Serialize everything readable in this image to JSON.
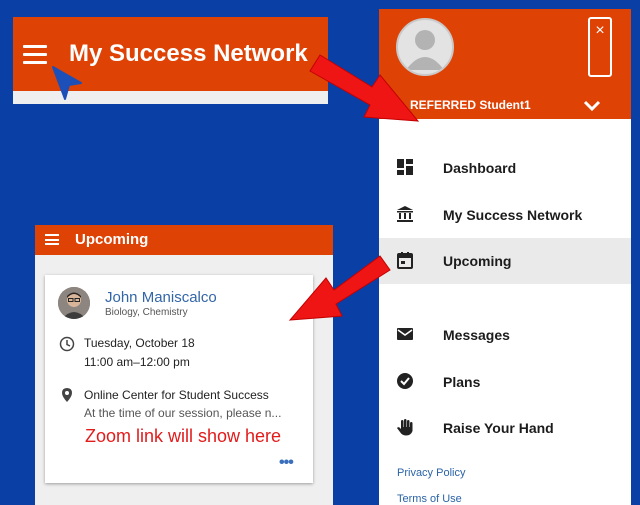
{
  "header": {
    "title": "My Success Network"
  },
  "drawer": {
    "close_label": "×",
    "user_name": "REFERRED Student1",
    "items": [
      {
        "label": "Dashboard",
        "icon": "dashboard-icon"
      },
      {
        "label": "My Success Network",
        "icon": "institution-icon"
      },
      {
        "label": "Upcoming",
        "icon": "calendar-icon",
        "selected": true
      },
      {
        "label": "Messages",
        "icon": "mail-icon"
      },
      {
        "label": "Plans",
        "icon": "check-circle-icon"
      },
      {
        "label": "Raise Your Hand",
        "icon": "hand-icon"
      }
    ],
    "links": [
      "Privacy Policy",
      "Terms of Use"
    ]
  },
  "upcoming": {
    "title": "Upcoming",
    "card": {
      "name": "John Maniscalco",
      "dept": "Biology, Chemistry",
      "date": "Tuesday, October 18",
      "time": "11:00 am–12:00 pm",
      "location": "Online Center for Student Success",
      "location_note": "At the time of our session, please n...",
      "annotation": "Zoom link will show here",
      "more": "•••"
    }
  },
  "colors": {
    "brand": "#de4205",
    "background": "#0a3fa6",
    "arrow": "#f01515",
    "link": "#2a63a8"
  }
}
